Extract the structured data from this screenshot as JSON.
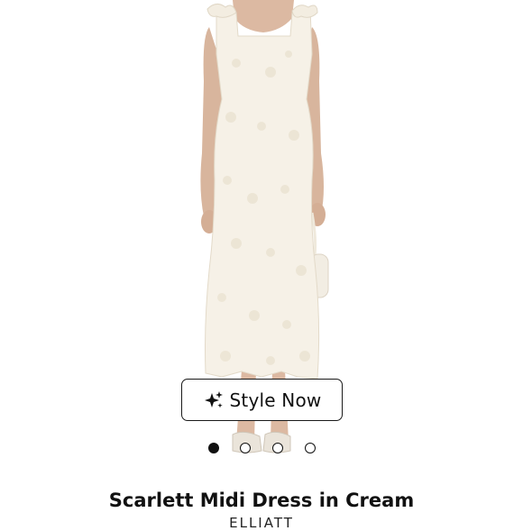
{
  "product": {
    "image_alt": "Model wearing a cream sleeveless midi dress with 3D butterfly appliqués, holding a white shoulder bag",
    "title": "Scarlett Midi Dress in Cream",
    "brand": "ELLIATT"
  },
  "style_now": {
    "label": "Style Now",
    "icon": "sparkles-icon"
  },
  "carousel": {
    "total": 4,
    "active_index": 0
  },
  "colors": {
    "dress": "#f6f1e7",
    "skin": "#dcb9a2",
    "text": "#111111"
  }
}
